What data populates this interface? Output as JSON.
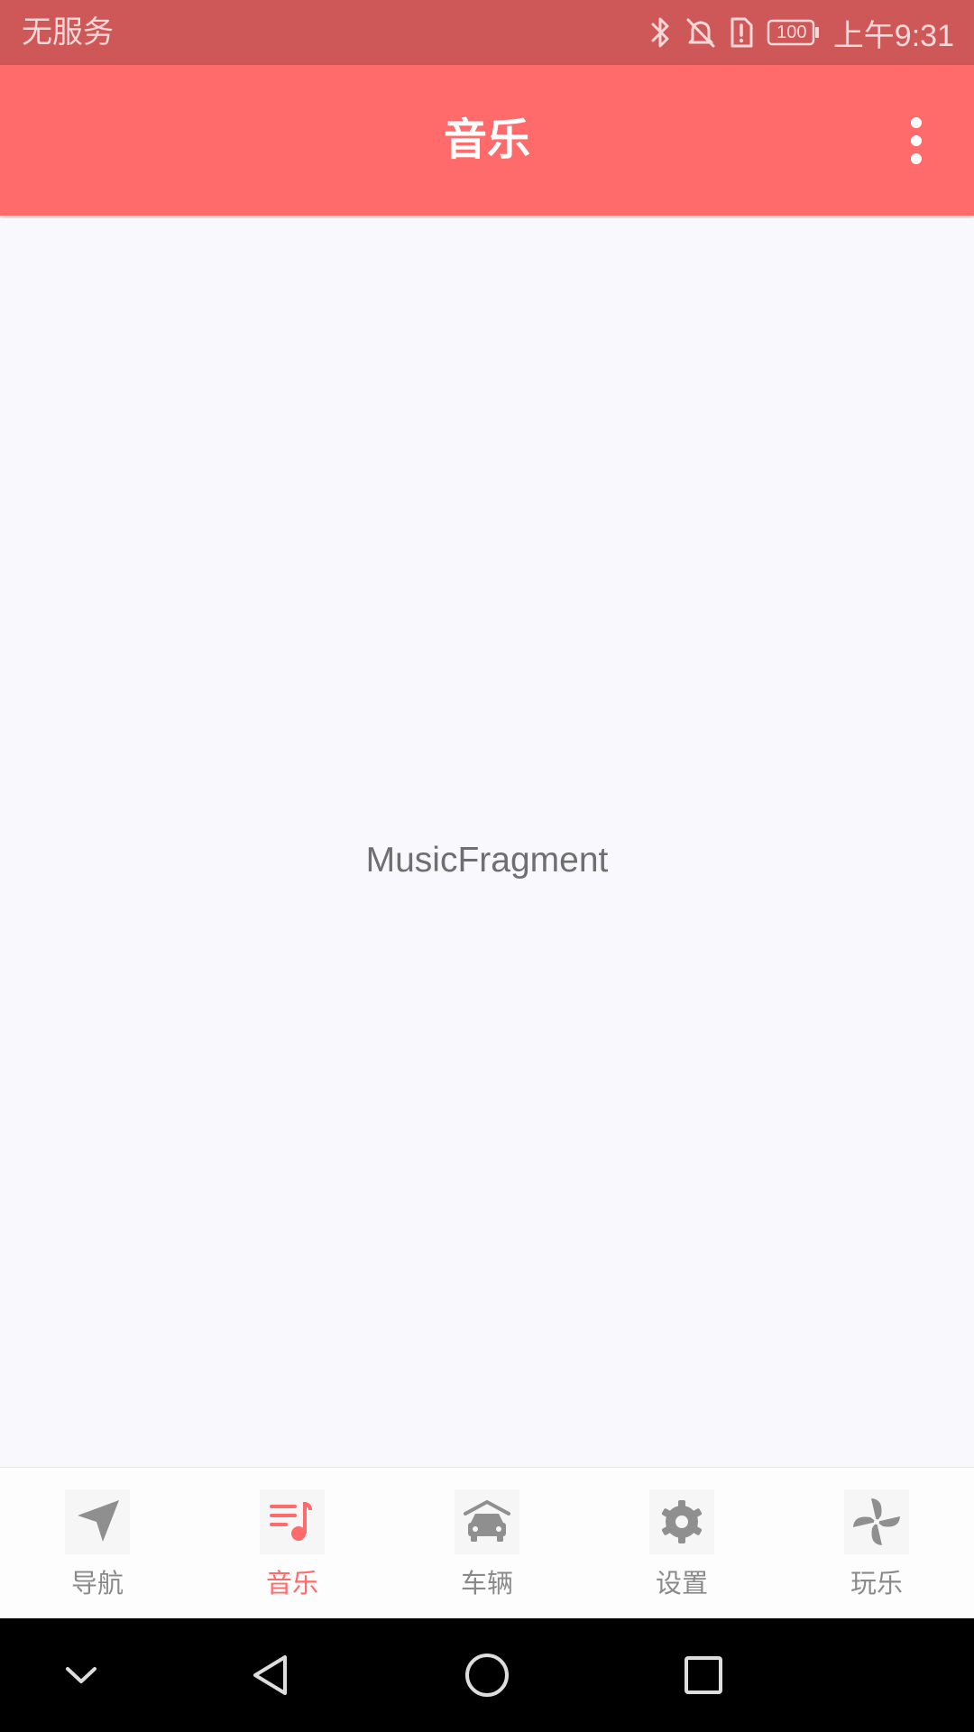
{
  "status_bar": {
    "carrier": "无服务",
    "battery": "100",
    "time": "上午9:31",
    "icons": [
      "bluetooth-icon",
      "mute-icon",
      "alert-icon",
      "battery-icon"
    ]
  },
  "app_bar": {
    "title": "音乐",
    "menu_icon": "more-vertical-icon"
  },
  "main": {
    "fragment_text": "MusicFragment"
  },
  "bottom_nav": {
    "items": [
      {
        "label": "导航",
        "icon": "navigation-arrow-icon",
        "active": false
      },
      {
        "label": "音乐",
        "icon": "music-list-icon",
        "active": true
      },
      {
        "label": "车辆",
        "icon": "car-icon",
        "active": false
      },
      {
        "label": "设置",
        "icon": "gear-icon",
        "active": false
      },
      {
        "label": "玩乐",
        "icon": "pinwheel-icon",
        "active": false
      }
    ]
  },
  "system_nav": {
    "buttons": [
      "hide-keyboard-icon",
      "back-icon",
      "home-icon",
      "recents-icon"
    ]
  },
  "colors": {
    "status_bar": "#ce5858",
    "app_bar": "#ff6b6b",
    "active_tab": "#ff6b6b",
    "inactive_tab": "#8a8a8a",
    "background": "#f8f8fd"
  }
}
